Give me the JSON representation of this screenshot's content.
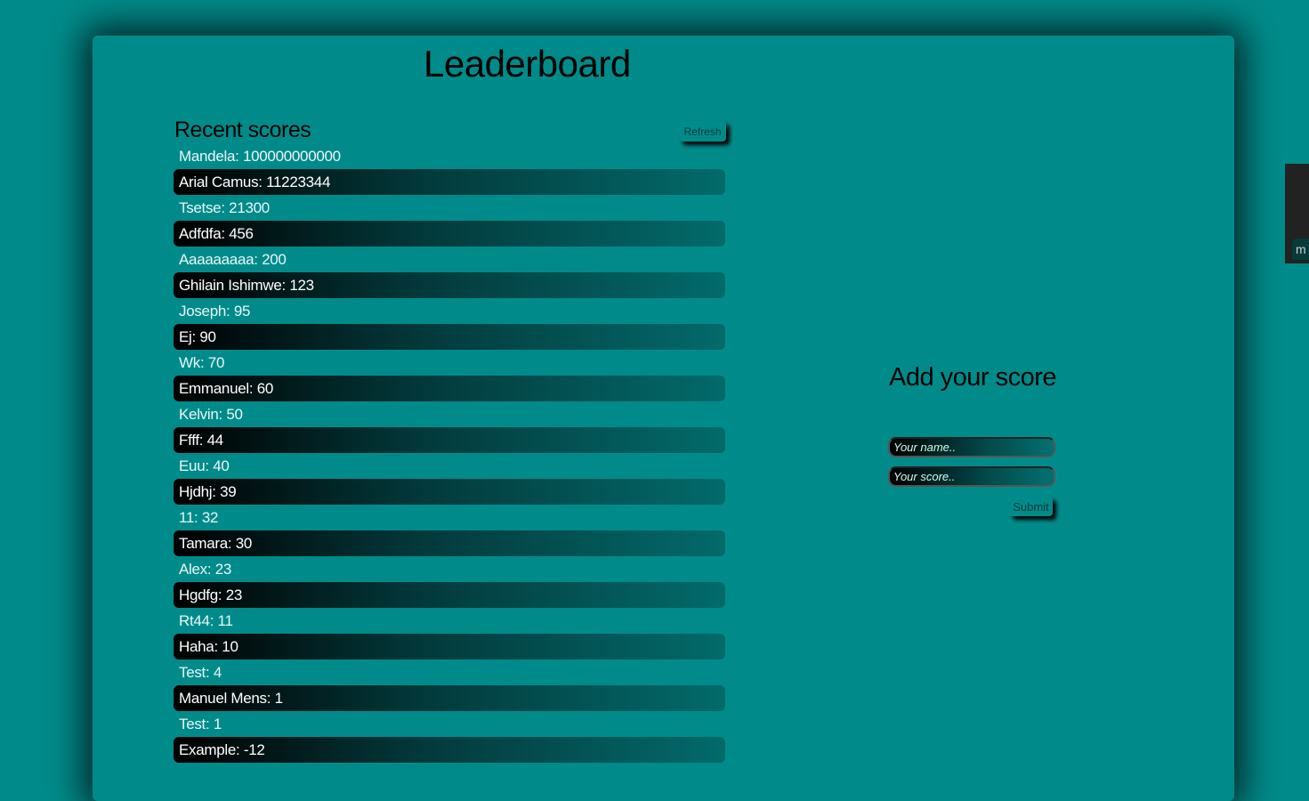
{
  "title": "Leaderboard",
  "recent": {
    "heading": "Recent scores",
    "refresh_label": "Refresh",
    "scores": [
      "Mandela: 100000000000",
      "Arial Camus: 11223344",
      "Tsetse: 21300",
      "Adfdfa: 456",
      "Aaaaaaaaa: 200",
      "Ghilain Ishimwe: 123",
      "Joseph: 95",
      "Ej: 90",
      "Wk: 70",
      "Emmanuel: 60",
      "Kelvin: 50",
      "Ffff: 44",
      "Euu: 40",
      "Hjdhj: 39",
      "11: 32",
      "Tamara: 30",
      "Alex: 23",
      "Hgdfg: 23",
      "Rt44: 11",
      "Haha: 10",
      "Test: 4",
      "Manuel Mens: 1",
      "Test: 1",
      "Example: -12"
    ]
  },
  "form": {
    "heading": "Add your score",
    "name_placeholder": "Your name..",
    "score_placeholder": "Your score..",
    "submit_label": "Submit"
  },
  "side_panel": {
    "label": "m"
  },
  "colors": {
    "background": "#008b8a"
  }
}
